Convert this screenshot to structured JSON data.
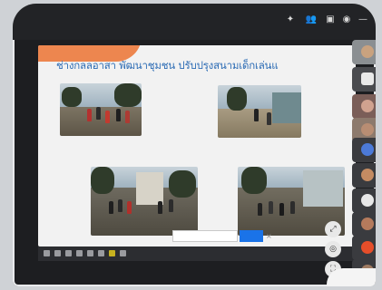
{
  "slide": {
    "title": "ช่างกลลอาสา  พัฒนาชุมชน  ปรับปรุงสนามเด็กเล่นแ"
  },
  "toolbar": {
    "icons": [
      "signal-icon",
      "participants-icon",
      "chat-icon",
      "info-icon",
      "more-icon"
    ]
  },
  "slide_controls": {
    "search_placeholder": "",
    "go_label": ""
  },
  "colors": {
    "accent": "#1a73e8",
    "title": "#2e6db5",
    "orange": "#ec7a3d"
  }
}
